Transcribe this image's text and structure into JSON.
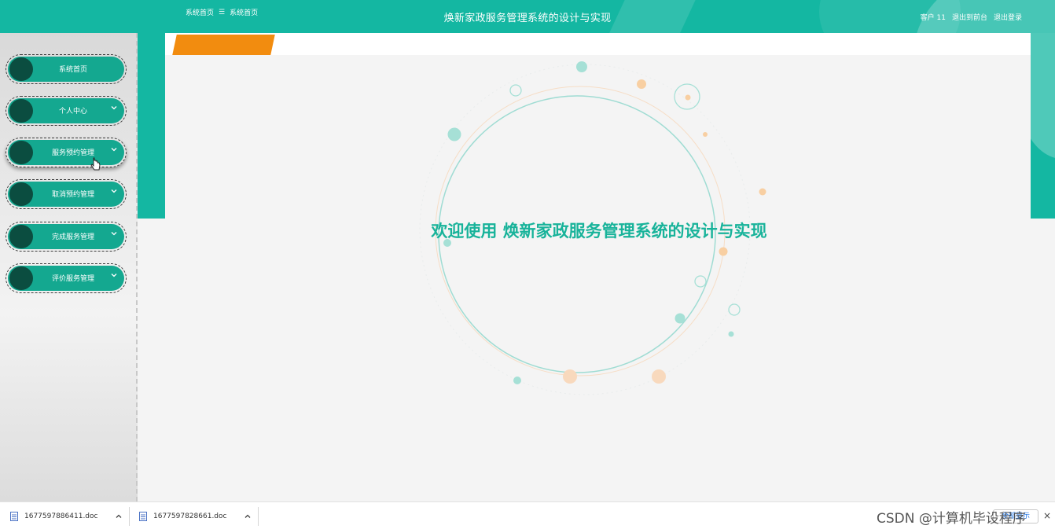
{
  "header": {
    "title": "焕新家政服务管理系统的设计与实现",
    "user_label": "客户 11",
    "back_label": "退出到前台",
    "logout_label": "退出登录"
  },
  "sidebar": {
    "items": [
      {
        "label": "系统首页",
        "has_chevron": false
      },
      {
        "label": "个人中心",
        "has_chevron": true
      },
      {
        "label": "服务预约管理",
        "has_chevron": true
      },
      {
        "label": "取消预约管理",
        "has_chevron": true
      },
      {
        "label": "完成服务管理",
        "has_chevron": true
      },
      {
        "label": "评价服务管理",
        "has_chevron": true
      }
    ]
  },
  "breadcrumb": {
    "first": "系统首页",
    "separator": "☰",
    "second": "系统首页"
  },
  "main": {
    "welcome": "欢迎使用 焕新家政服务管理系统的设计与实现"
  },
  "downloads": {
    "items": [
      {
        "filename": "1677597886411.doc"
      },
      {
        "filename": "1677597828661.doc"
      }
    ],
    "show_all": "全部显示",
    "close": "×"
  },
  "watermark": "CSDN @计算机毕设程序",
  "colors": {
    "primary": "#14b7a2",
    "menu_pill": "#14a890",
    "menu_dot": "#0b4d40",
    "breadcrumb": "#f28c0f",
    "welcome_text": "#18b39a"
  }
}
